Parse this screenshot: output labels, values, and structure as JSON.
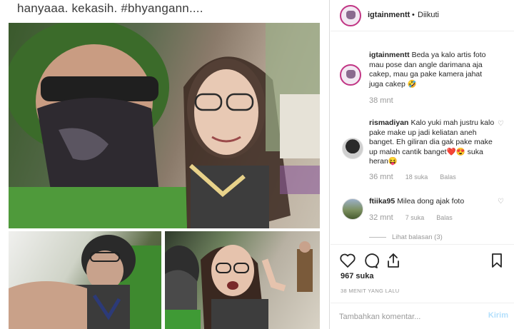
{
  "post": {
    "caption_top": "hanyaaa. kekasih. #bhyangann....",
    "photo_main_alt": "",
    "photo_bl_alt": "",
    "photo_br_alt": ""
  },
  "header": {
    "username": "igtainmentt",
    "separator": "•",
    "follow_status": "Diikuti",
    "more": "..."
  },
  "comments": [
    {
      "username": "igtainmentt",
      "text": "Beda ya kalo artis foto mau pose dan angle darimana aja cakep, mau ga pake kamera jahat juga cakep 🤣",
      "time": "38 mnt",
      "likes": "",
      "reply": ""
    },
    {
      "username": "rismadiyan",
      "text": "Kalo yuki mah justru kalo pake make up jadi keliatan aneh banget. Eh giliran dia gak pake make up malah cantik banget❤️😍 suka heran😝",
      "time": "36 mnt",
      "likes": "18 suka",
      "reply": "Balas"
    },
    {
      "username": "ftiika95",
      "text": "Milea dong ajak foto",
      "time": "32 mnt",
      "likes": "7 suka",
      "reply": "Balas"
    }
  ],
  "view_replies": "Lihat balasan (3)",
  "actions": {
    "heart_icon": "heart-outline-icon",
    "comment_icon": "comment-bubble-icon",
    "share_icon": "share-icon",
    "save_icon": "bookmark-icon"
  },
  "likes": "967 suka",
  "timestamp": "38 MENIT YANG LALU",
  "add_comment": {
    "placeholder": "Tambahkan komentar...",
    "post_label": "Kirim"
  },
  "colors": {
    "text": "#262626",
    "muted": "#999999",
    "border": "#efefef",
    "post_disabled": "#b2dffc"
  }
}
